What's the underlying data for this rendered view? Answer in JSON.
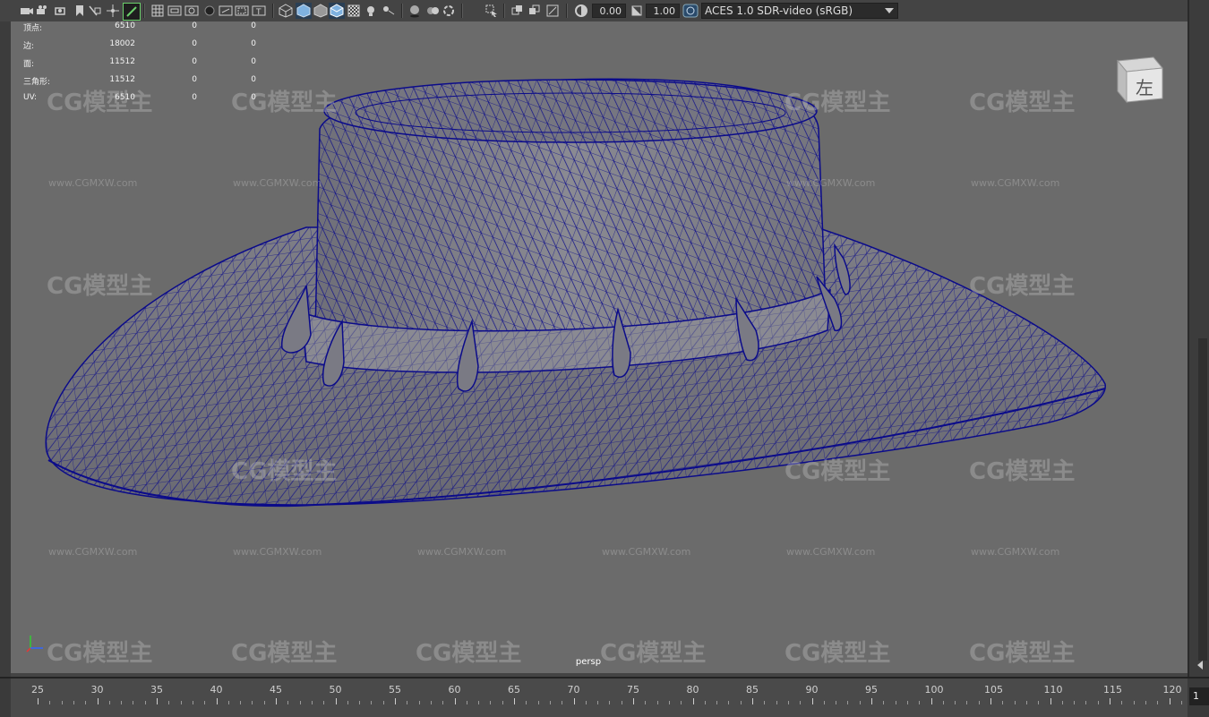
{
  "toolbar": {
    "exposure_value": "0.00",
    "gamma_value": "1.00",
    "color_management_view": "ACES 1.0 SDR-video (sRGB)"
  },
  "hud": {
    "rows": [
      {
        "label": "顶点:",
        "v1": "6510",
        "v2": "0",
        "v3": "0"
      },
      {
        "label": "边:",
        "v1": "18002",
        "v2": "0",
        "v3": "0"
      },
      {
        "label": "面:",
        "v1": "11512",
        "v2": "0",
        "v3": "0"
      },
      {
        "label": "三角形:",
        "v1": "11512",
        "v2": "0",
        "v3": "0"
      },
      {
        "label": "UV:",
        "v1": "6510",
        "v2": "0",
        "v3": "0"
      }
    ]
  },
  "viewcube": {
    "face_label": "左"
  },
  "viewport": {
    "camera_label": "persp"
  },
  "watermark": {
    "logo_text": "CG模型主",
    "url_text": "www.CGMXW.com"
  },
  "timeline": {
    "ticks": [
      "25",
      "30",
      "35",
      "40",
      "45",
      "50",
      "55",
      "60",
      "65",
      "70",
      "75",
      "80",
      "85",
      "90",
      "95",
      "100",
      "105",
      "110",
      "115",
      "120"
    ],
    "current_frame": "1"
  },
  "colors": {
    "wireframe": "#0a0a8c",
    "viewport_bg": "#6b6b6b",
    "toolbar_bg": "#444444"
  }
}
